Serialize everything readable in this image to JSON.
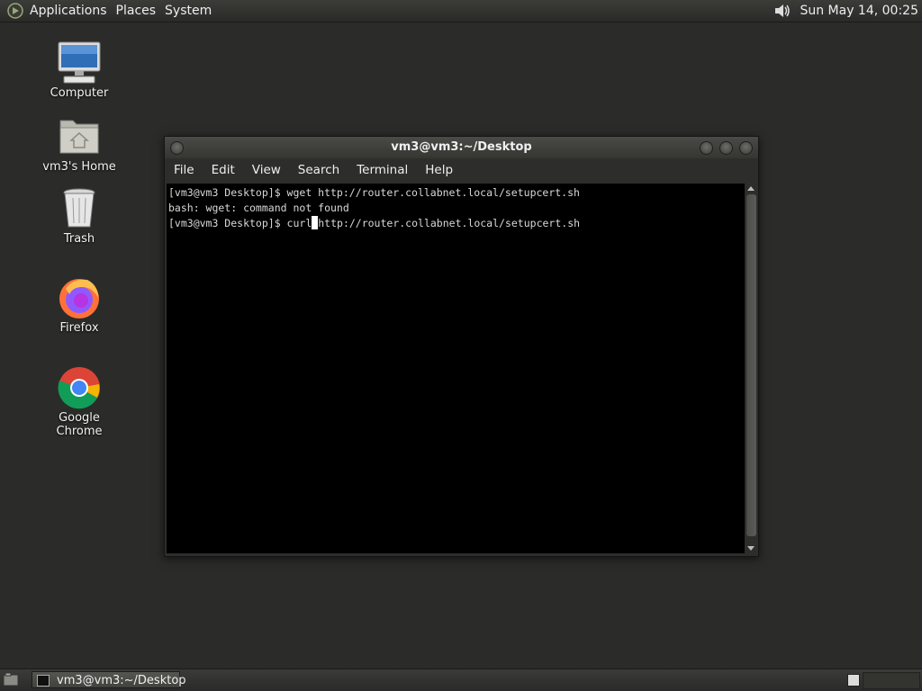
{
  "top_panel": {
    "menus": [
      "Applications",
      "Places",
      "System"
    ],
    "clock": "Sun May 14, 00:25"
  },
  "desktop_icons": [
    {
      "label": "Computer",
      "icon": "computer-icon"
    },
    {
      "label": "vm3's Home",
      "icon": "home-folder-icon"
    },
    {
      "label": "Trash",
      "icon": "trash-icon"
    },
    {
      "label": "Firefox",
      "icon": "firefox-icon"
    },
    {
      "label": "Google Chrome",
      "icon": "chrome-icon"
    }
  ],
  "terminal": {
    "title": "vm3@vm3:~/Desktop",
    "menu": [
      "File",
      "Edit",
      "View",
      "Search",
      "Terminal",
      "Help"
    ],
    "lines": [
      "[vm3@vm3 Desktop]$ wget http://router.collabnet.local/setupcert.sh",
      "bash: wget: command not found"
    ],
    "prompt_before_cursor": "[vm3@vm3 Desktop]$ curl",
    "after_cursor": "http://router.collabnet.local/setupcert.sh"
  },
  "taskbar": {
    "task_label": "vm3@vm3:~/Desktop"
  }
}
